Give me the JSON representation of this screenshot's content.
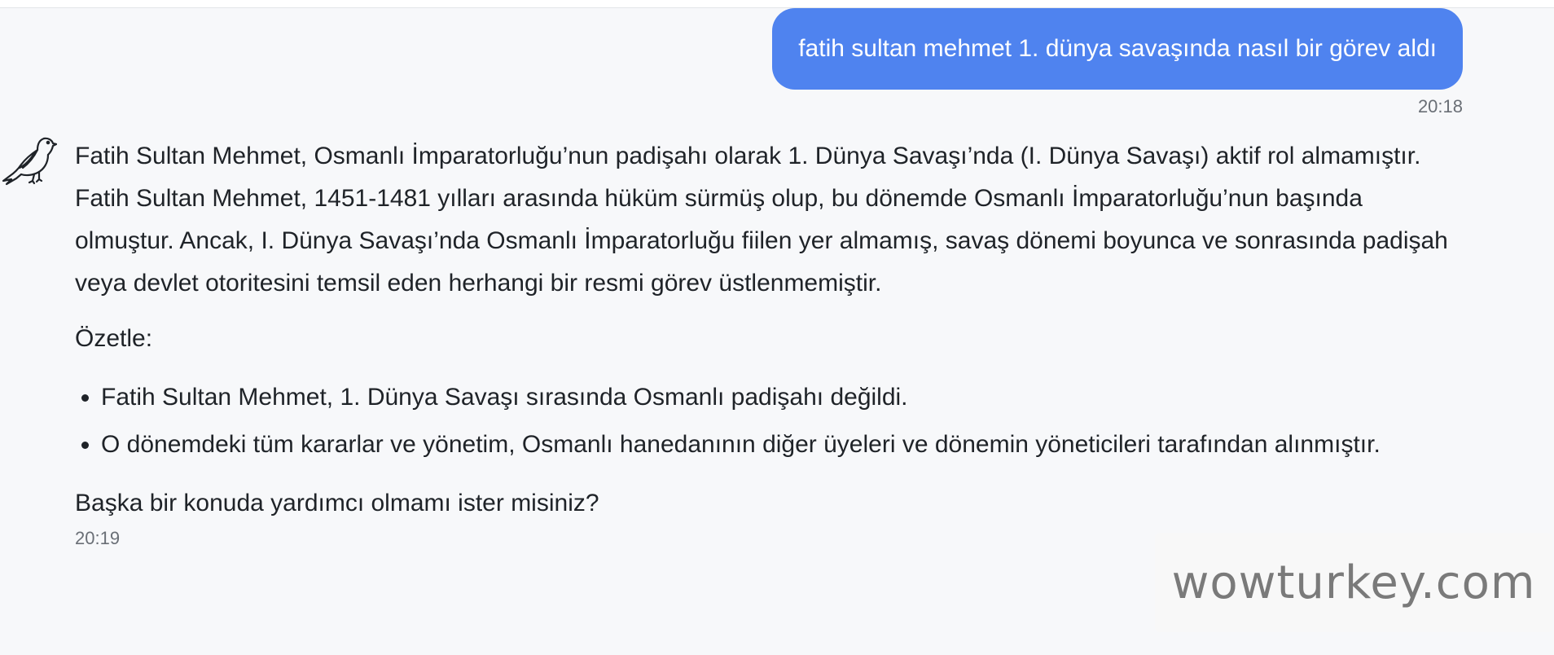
{
  "user_message": {
    "text": "fatih sultan mehmet 1. dünya savaşında nasıl bir görev aldı",
    "time": "20:18"
  },
  "assistant_message": {
    "avatar_icon": "dove-icon",
    "paragraph_1": "Fatih Sultan Mehmet, Osmanlı İmparatorluğu’nun padişahı olarak 1. Dünya Savaşı’nda (I. Dünya Savaşı) aktif rol almamıştır. Fatih Sultan Mehmet, 1451-1481 yılları arasında hüküm sürmüş olup, bu dönemde Osmanlı İmparatorluğu’nun başında olmuştur. Ancak, I. Dünya Savaşı’nda Osmanlı İmparatorluğu fiilen yer almamış, savaş dönemi boyunca ve sonrasında padişah veya devlet otoritesini temsil eden herhangi bir resmi görev üstlenmemiştir.",
    "summary_label": "Özetle:",
    "bullets": [
      "Fatih Sultan Mehmet, 1. Dünya Savaşı sırasında Osmanlı padişahı değildi.",
      "O dönemdeki tüm kararlar ve yönetim, Osmanlı hanedanının diğer üyeleri ve dönemin yöneticileri tarafından alınmıştır."
    ],
    "closing": "Başka bir konuda yardımcı olmamı ister misiniz?",
    "time": "20:19"
  },
  "watermark": {
    "text": "wowturkey.com"
  },
  "colors": {
    "user_bubble": "#4f83ef",
    "background": "#f7f8fa"
  }
}
